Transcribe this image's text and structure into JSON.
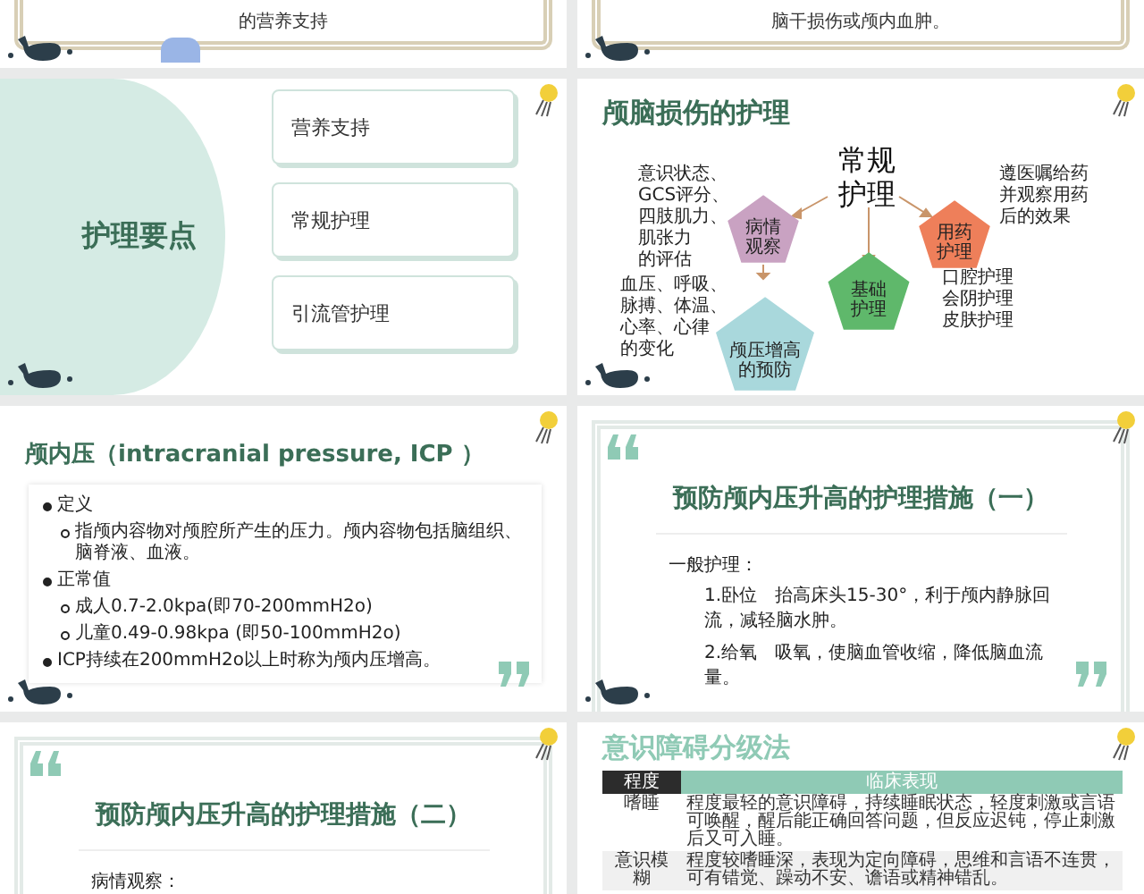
{
  "slides": [
    {
      "kind": "caption_end",
      "badge": true,
      "text": "的营养支持"
    },
    {
      "kind": "caption_end",
      "badge": false,
      "text": "脑干损伤或颅内血肿。"
    },
    {
      "kind": "agenda",
      "title": "护理要点",
      "items": [
        "营养支持",
        "常规护理",
        "引流管护理"
      ]
    },
    {
      "kind": "diagram",
      "title": "颅脑损伤的护理",
      "center": "常规护理",
      "nodes": [
        {
          "label": "病情观察",
          "color": "#c9a2c2",
          "notes": [
            "意识状态、",
            "GCS评分、",
            "四肢肌力、",
            "肌张力",
            "的评估"
          ]
        },
        {
          "label": "用药护理",
          "color": "#ee7f5a",
          "notes": [
            "遵医嘱给药",
            "并观察用药",
            "后的效果"
          ]
        },
        {
          "label": "颅压增高的预防",
          "color": "#a9d8dc",
          "notes": [
            "血压、呼吸、",
            "脉搏、体温、",
            "心率、心律",
            "的变化"
          ]
        },
        {
          "label": "基础护理",
          "color": "#5fb86b",
          "notes": [
            "口腔护理",
            "会阴护理",
            "皮肤护理"
          ]
        }
      ]
    },
    {
      "kind": "bullets",
      "title": "颅内压（intracranial pressure, ICP ）",
      "items": [
        {
          "text": "定义",
          "children": [
            {
              "text": "指颅内容物对颅腔所产生的压力。颅内容物包括脑组织、脑脊液、血液。"
            }
          ]
        },
        {
          "text": "正常值",
          "children": [
            {
              "text": "成人0.7-2.0kpa(即70-200mmH2o)"
            },
            {
              "text": "儿童0.49-0.98kpa (即50-100mmH2o)"
            }
          ]
        },
        {
          "text": "ICP持续在200mmH2o以上时称为颅内压增高。"
        }
      ]
    },
    {
      "kind": "quote_text",
      "title": "预防颅内压升高的护理措施（一）",
      "lead": "一般护理：",
      "lines": [
        "1.卧位　抬高床头15-30°，利于颅内静脉回流，减轻脑水肿。",
        "2.给氧　吸氧，使脑血管收缩，降低脑血流量。"
      ]
    },
    {
      "kind": "quote_text",
      "title": "预防颅内压升高的护理措施（二）",
      "lead": "病情观察："
    },
    {
      "kind": "table",
      "title": "意识障碍分级法",
      "columns": [
        "程度",
        "临床表现"
      ],
      "rows": [
        [
          "嗜睡",
          "程度最轻的意识障碍，持续睡眠状态，轻度刺激或言语可唤醒，醒后能正确回答问题，但反应迟钝，停止刺激后又可入睡。"
        ],
        [
          "意识模糊",
          "程度较嗜睡深，表现为定向障碍，思维和言语不连贯，可有错觉、躁动不安、谵语或精神错乱。"
        ]
      ]
    }
  ]
}
